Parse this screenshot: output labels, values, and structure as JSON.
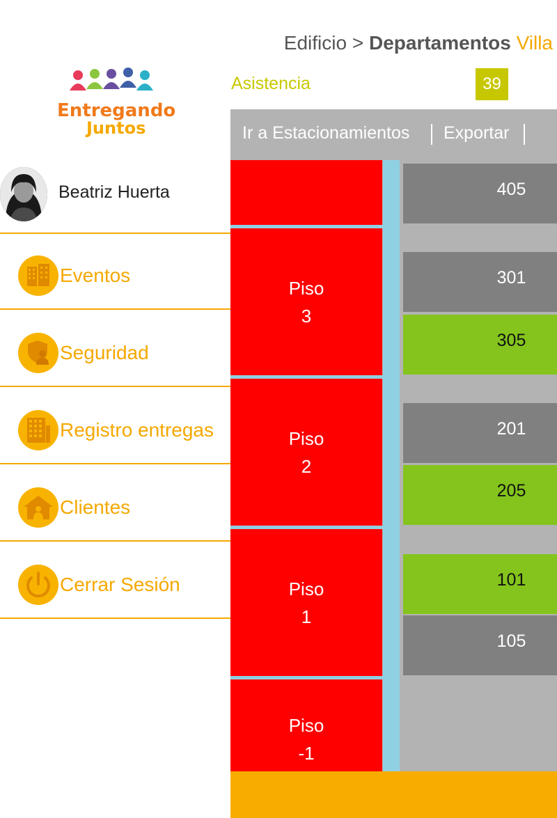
{
  "header": {
    "breadcrumb_root": "Edificio >",
    "breadcrumb_current": "Departamentos",
    "breadcrumb_suffix": "Villa"
  },
  "logo": {
    "line1": "Entregando",
    "line2": "Juntos"
  },
  "user": {
    "name": "Beatriz Huerta"
  },
  "menu": [
    {
      "label": "Eventos",
      "icon": "building-icon"
    },
    {
      "label": "Seguridad",
      "icon": "shield-user-icon"
    },
    {
      "label": "Registro entregas",
      "icon": "apartment-building-icon"
    },
    {
      "label": "Clientes",
      "icon": "house-user-icon"
    },
    {
      "label": "Cerrar Sesión",
      "icon": "power-icon"
    }
  ],
  "asistencia": {
    "label": "Asistencia",
    "count": "39"
  },
  "toolbar": {
    "parking_label": "Ir a Estacionamientos",
    "export_label": "Exportar"
  },
  "floors": [
    {
      "label": "Piso",
      "number": "3"
    },
    {
      "label": "Piso",
      "number": "2"
    },
    {
      "label": "Piso",
      "number": "1"
    },
    {
      "label": "Piso",
      "number": "-1"
    }
  ],
  "units": [
    {
      "number": "405",
      "status": "gray"
    },
    {
      "number": "301",
      "status": "gray"
    },
    {
      "number": "305",
      "status": "green"
    },
    {
      "number": "201",
      "status": "gray"
    },
    {
      "number": "205",
      "status": "green"
    },
    {
      "number": "101",
      "status": "green"
    },
    {
      "number": "105",
      "status": "gray"
    }
  ],
  "colors": {
    "accent": "#f5a800",
    "floor_red": "#ff0000",
    "unit_gray": "#808080",
    "unit_green": "#84c41d",
    "elevator_blue": "#8fd0e2",
    "asistencia": "#c7c700"
  }
}
